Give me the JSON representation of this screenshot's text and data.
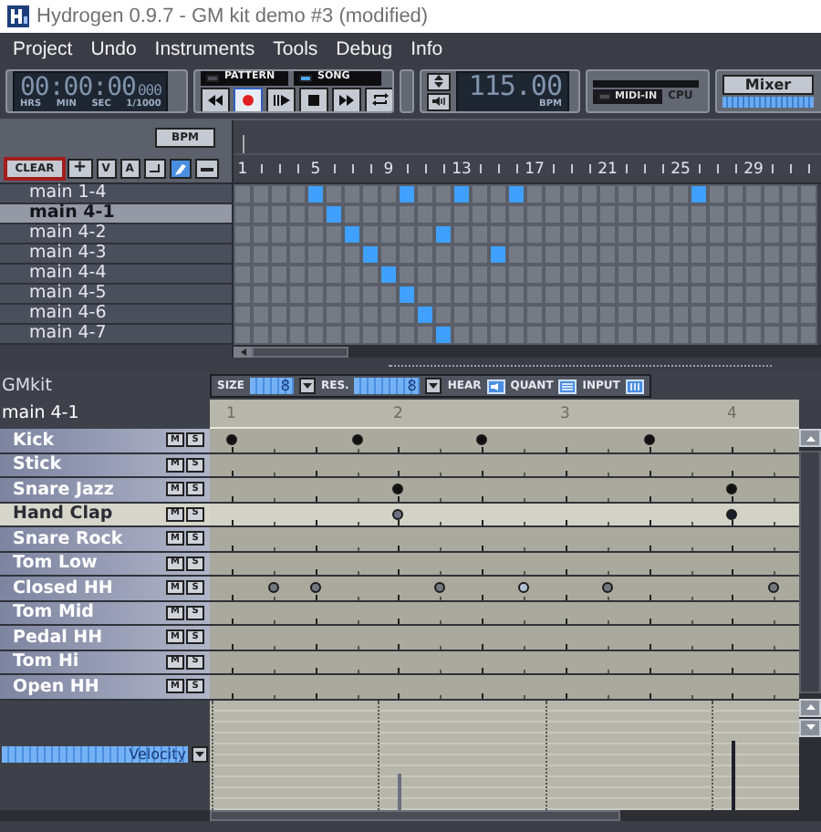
{
  "window": {
    "title": "Hydrogen 0.9.7 - GM kit demo #3 (modified)"
  },
  "menu": [
    "Project",
    "Undo",
    "Instruments",
    "Tools",
    "Debug",
    "Info"
  ],
  "toolbar": {
    "time": "00:00:00",
    "millis": "000",
    "time_labels": [
      "HRS",
      "MIN",
      "SEC",
      "1/1000"
    ],
    "modes": [
      {
        "label": "PATTERN",
        "selected": false
      },
      {
        "label": "SONG",
        "selected": true
      }
    ],
    "transport": [
      {
        "kind": "rewind",
        "on": false
      },
      {
        "kind": "record",
        "on": true
      },
      {
        "kind": "play",
        "on": false
      },
      {
        "kind": "stop",
        "on": false
      },
      {
        "kind": "forward",
        "on": false
      },
      {
        "kind": "loop",
        "on": false
      }
    ],
    "bpm": "115.00",
    "bpm_label": "BPM",
    "midi_label": "MIDI-IN",
    "cpu_label": "CPU",
    "mixer_button": "Mixer"
  },
  "song": {
    "bpm_button": "BPM",
    "clear_button": "CLEAR",
    "add_button": "+",
    "v_button": "V",
    "a_button": "A",
    "ruler": [
      "1",
      "5",
      "9",
      "13",
      "17",
      "21",
      "25",
      "29"
    ],
    "patterns": [
      {
        "name": "main 1-4",
        "selected": false,
        "cells": [
          false,
          false,
          false,
          false,
          true,
          false,
          false,
          false,
          false,
          true,
          false,
          false,
          true,
          false,
          false,
          true,
          false,
          false,
          false,
          false,
          false,
          false,
          false,
          false,
          false,
          true,
          false,
          false,
          false,
          false,
          false,
          false
        ]
      },
      {
        "name": "main 4-1",
        "selected": true,
        "cells": [
          false,
          false,
          false,
          false,
          false,
          true,
          false,
          false,
          false,
          false,
          false,
          false,
          false,
          false,
          false,
          false,
          false,
          false,
          false,
          false,
          false,
          false,
          false,
          false,
          false,
          false,
          false,
          false,
          false,
          false,
          false,
          false
        ]
      },
      {
        "name": "main 4-2",
        "selected": false,
        "cells": [
          false,
          false,
          false,
          false,
          false,
          false,
          true,
          false,
          false,
          false,
          false,
          true,
          false,
          false,
          false,
          false,
          false,
          false,
          false,
          false,
          false,
          false,
          false,
          false,
          false,
          false,
          false,
          false,
          false,
          false,
          false,
          false
        ]
      },
      {
        "name": "main 4-3",
        "selected": false,
        "cells": [
          false,
          false,
          false,
          false,
          false,
          false,
          false,
          true,
          false,
          false,
          false,
          false,
          false,
          false,
          true,
          false,
          false,
          false,
          false,
          false,
          false,
          false,
          false,
          false,
          false,
          false,
          false,
          false,
          false,
          false,
          false,
          false
        ]
      },
      {
        "name": "main 4-4",
        "selected": false,
        "cells": [
          false,
          false,
          false,
          false,
          false,
          false,
          false,
          false,
          true,
          false,
          false,
          false,
          false,
          false,
          false,
          false,
          false,
          false,
          false,
          false,
          false,
          false,
          false,
          false,
          false,
          false,
          false,
          false,
          false,
          false,
          false,
          false
        ]
      },
      {
        "name": "main 4-5",
        "selected": false,
        "cells": [
          false,
          false,
          false,
          false,
          false,
          false,
          false,
          false,
          false,
          true,
          false,
          false,
          false,
          false,
          false,
          false,
          false,
          false,
          false,
          false,
          false,
          false,
          false,
          false,
          false,
          false,
          false,
          false,
          false,
          false,
          false,
          false
        ]
      },
      {
        "name": "main 4-6",
        "selected": false,
        "cells": [
          false,
          false,
          false,
          false,
          false,
          false,
          false,
          false,
          false,
          false,
          true,
          false,
          false,
          false,
          false,
          false,
          false,
          false,
          false,
          false,
          false,
          false,
          false,
          false,
          false,
          false,
          false,
          false,
          false,
          false,
          false,
          false
        ]
      },
      {
        "name": "main 4-7",
        "selected": false,
        "cells": [
          false,
          false,
          false,
          false,
          false,
          false,
          false,
          false,
          false,
          false,
          false,
          true,
          false,
          false,
          false,
          false,
          false,
          false,
          false,
          false,
          false,
          false,
          false,
          false,
          false,
          false,
          false,
          false,
          false,
          false,
          false,
          false
        ]
      }
    ]
  },
  "pattern_editor": {
    "drumkit": "GMkit",
    "size_label": "SIZE",
    "size_value": "8",
    "res_label": "RES.",
    "res_value": "8",
    "hear_label": "HEAR",
    "quant_label": "QUANT",
    "input_label": "INPUT",
    "pattern_name": "main 4-1",
    "beats": [
      "1",
      "2",
      "3",
      "4"
    ],
    "instruments": [
      {
        "name": "Kick",
        "selected": false,
        "mute": "M",
        "solo": "S",
        "steps": [
          {
            "color": "#111111"
          },
          false,
          false,
          {
            "color": "#111111"
          },
          false,
          false,
          {
            "color": "#111111"
          },
          false,
          false,
          false,
          {
            "color": "#111111"
          },
          false,
          false,
          false
        ]
      },
      {
        "name": "Stick",
        "selected": false,
        "mute": "M",
        "solo": "S",
        "steps": [
          false,
          false,
          false,
          false,
          false,
          false,
          false,
          false,
          false,
          false,
          false,
          false,
          false,
          false
        ]
      },
      {
        "name": "Snare Jazz",
        "selected": false,
        "mute": "M",
        "solo": "S",
        "steps": [
          false,
          false,
          false,
          false,
          {
            "color": "#111111"
          },
          false,
          false,
          false,
          false,
          false,
          false,
          false,
          {
            "color": "#111111"
          },
          false
        ]
      },
      {
        "name": "Hand Clap",
        "selected": true,
        "mute": "M",
        "solo": "S",
        "steps": [
          false,
          false,
          false,
          false,
          {
            "color": "#6c7080",
            "level": 0.33
          },
          false,
          false,
          false,
          false,
          false,
          false,
          false,
          {
            "color": "#1c1e2a",
            "level": 0.62
          },
          false
        ]
      },
      {
        "name": "Snare Rock",
        "selected": false,
        "mute": "M",
        "solo": "S",
        "steps": [
          false,
          false,
          false,
          false,
          false,
          false,
          false,
          false,
          false,
          false,
          false,
          false,
          false,
          false
        ]
      },
      {
        "name": "Tom Low",
        "selected": false,
        "mute": "M",
        "solo": "S",
        "steps": [
          false,
          false,
          false,
          false,
          false,
          false,
          false,
          false,
          false,
          false,
          false,
          false,
          false,
          false
        ]
      },
      {
        "name": "Closed HH",
        "selected": false,
        "mute": "M",
        "solo": "S",
        "steps": [
          false,
          {
            "color": "#72767e"
          },
          {
            "color": "#72767e"
          },
          false,
          false,
          {
            "color": "#72767e"
          },
          false,
          {
            "color": "#b4c0d6"
          },
          false,
          {
            "color": "#72767e"
          },
          false,
          false,
          false,
          {
            "color": "#72767e"
          }
        ]
      },
      {
        "name": "Tom Mid",
        "selected": false,
        "mute": "M",
        "solo": "S",
        "steps": [
          false,
          false,
          false,
          false,
          false,
          false,
          false,
          false,
          false,
          false,
          false,
          false,
          false,
          false
        ]
      },
      {
        "name": "Pedal HH",
        "selected": false,
        "mute": "M",
        "solo": "S",
        "steps": [
          false,
          false,
          false,
          false,
          false,
          false,
          false,
          false,
          false,
          false,
          false,
          false,
          false,
          false
        ]
      },
      {
        "name": "Tom Hi",
        "selected": false,
        "mute": "M",
        "solo": "S",
        "steps": [
          false,
          false,
          false,
          false,
          false,
          false,
          false,
          false,
          false,
          false,
          false,
          false,
          false,
          false
        ]
      },
      {
        "name": "Open HH",
        "selected": false,
        "mute": "M",
        "solo": "S",
        "steps": [
          false,
          false,
          false,
          false,
          false,
          false,
          false,
          false,
          false,
          false,
          false,
          false,
          false,
          false
        ]
      }
    ],
    "velocity": {
      "label": "Velocity"
    }
  }
}
